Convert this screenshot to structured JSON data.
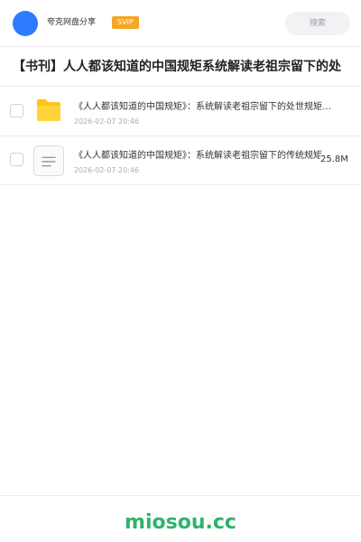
{
  "header": {
    "brand": "夸克网盘分享",
    "badge": "SVIP",
    "search_placeholder": "搜索"
  },
  "share": {
    "title": "【书刊】人人都该知道的中国规矩系统解读老祖宗留下的处"
  },
  "files": [
    {
      "name": "《人人都该知道的中国规矩》：系统解读老祖宗留下的处世规矩与智慧",
      "date": "2026-02-07 20:46",
      "type": "folder"
    },
    {
      "name": "《人人都该知道的中国规矩》：系统解读老祖宗留下的传统规矩",
      "date": "2026-02-07 20:46",
      "size": "25.8M",
      "type": "document"
    }
  ],
  "footer": {
    "watermark": "miosou.cc"
  },
  "colors": {
    "accent": "#2f7bff",
    "badge": "#f5a623",
    "folder": "#ffc21a",
    "watermark": "#2fb36a"
  }
}
